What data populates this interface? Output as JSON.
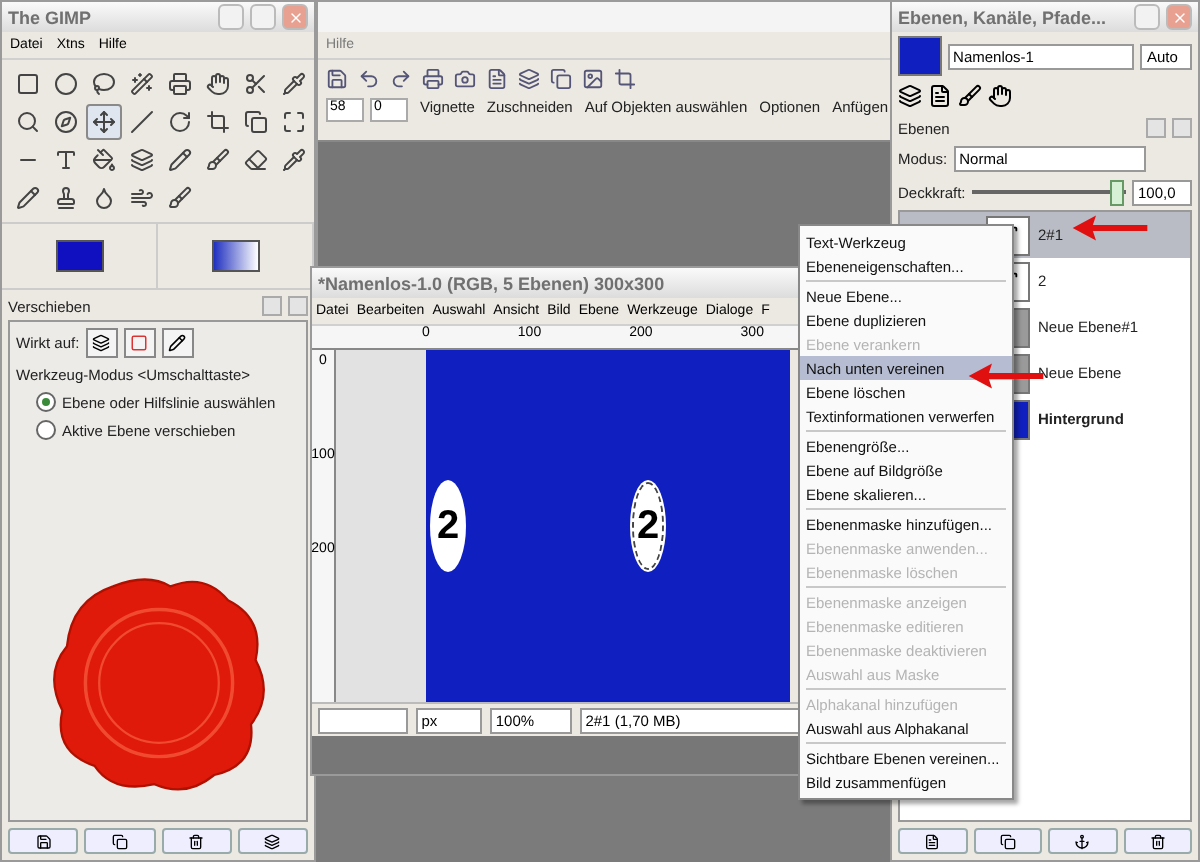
{
  "toolbox": {
    "title": "The GIMP",
    "menu": [
      "Datei",
      "Xtns",
      "Hilfe"
    ],
    "tools": [
      {
        "selected": false
      },
      {
        "selected": false
      },
      {
        "selected": false
      },
      {
        "selected": false
      },
      {
        "selected": false
      },
      {
        "selected": false
      },
      {
        "selected": false
      },
      {
        "selected": false
      },
      {
        "selected": false
      },
      {
        "selected": false
      },
      {
        "selected": true
      },
      {
        "selected": false
      },
      {
        "selected": false
      },
      {
        "selected": false
      },
      {
        "selected": false
      },
      {
        "selected": false
      },
      {
        "selected": false
      },
      {
        "selected": false
      },
      {
        "selected": false
      },
      {
        "selected": false
      },
      {
        "selected": false
      },
      {
        "selected": false
      },
      {
        "selected": false
      },
      {
        "selected": false
      },
      {
        "selected": false
      },
      {
        "selected": false
      },
      {
        "selected": false
      },
      {
        "selected": false
      },
      {
        "selected": false
      }
    ],
    "options": {
      "title": "Verschieben",
      "affects_label": "Wirkt auf:",
      "mode_label": "Werkzeug-Modus  <Umschalttaste>",
      "choices": [
        {
          "label": "Ebene oder Hilfslinie auswählen",
          "selected": true
        },
        {
          "label": "Aktive Ebene verschieben",
          "selected": false
        }
      ]
    }
  },
  "back_window": {
    "menu": [
      "Hilfe"
    ],
    "field_1": "58",
    "field_2": "0",
    "labels": [
      "Vignette",
      "Zuschneiden",
      "Auf Objekten auswählen",
      "Optionen",
      "Anfügen"
    ]
  },
  "image_window": {
    "title": "*Namenlos-1.0 (RGB, 5 Ebenen) 300x300",
    "menu": [
      "Datei",
      "Bearbeiten",
      "Auswahl",
      "Ansicht",
      "Bild",
      "Ebene",
      "Werkzeuge",
      "Dialoge",
      "F"
    ],
    "ruler_marks": [
      "0",
      "100",
      "200",
      "300"
    ],
    "side_marks": [
      "0",
      "100",
      "200"
    ],
    "canvas_labels": [
      {
        "text": "2",
        "selected": false
      },
      {
        "text": "2",
        "selected": true
      }
    ],
    "unit": "px",
    "zoom": "100%",
    "status": "2#1 (1,70 MB)"
  },
  "layers_window": {
    "title": "Ebenen, Kanäle, Pfade...",
    "image": "Namenlos-1",
    "auto": "Auto",
    "panel_title": "Ebenen",
    "mode_label": "Modus:",
    "mode": "Normal",
    "opacity_label": "Deckkraft:",
    "opacity": "100,0",
    "level": 1,
    "layers": [
      {
        "name": "2#1",
        "kind": "text",
        "selected": true
      },
      {
        "name": "2",
        "kind": "text",
        "selected": false
      },
      {
        "name": "Neue Ebene#1",
        "kind": "plain",
        "selected": false
      },
      {
        "name": "Neue Ebene",
        "kind": "plain",
        "selected": false
      },
      {
        "name": "Hintergrund",
        "kind": "background",
        "selected": false
      }
    ]
  },
  "context_menu": [
    {
      "kind": "item",
      "label": "Text-Werkzeug",
      "disabled": false,
      "selected": false
    },
    {
      "kind": "item",
      "label": "Ebeneneigenschaften...",
      "disabled": false,
      "selected": false
    },
    {
      "kind": "separator"
    },
    {
      "kind": "item",
      "label": "Neue Ebene...",
      "disabled": false,
      "selected": false
    },
    {
      "kind": "item",
      "label": "Ebene duplizieren",
      "disabled": false,
      "selected": false
    },
    {
      "kind": "item",
      "label": "Ebene verankern",
      "disabled": true,
      "selected": false
    },
    {
      "kind": "item",
      "label": "Nach unten vereinen",
      "disabled": false,
      "selected": true
    },
    {
      "kind": "item",
      "label": "Ebene löschen",
      "disabled": false,
      "selected": false
    },
    {
      "kind": "item",
      "label": "Textinformationen verwerfen",
      "disabled": false,
      "selected": false
    },
    {
      "kind": "separator"
    },
    {
      "kind": "item",
      "label": "Ebenengröße...",
      "disabled": false,
      "selected": false
    },
    {
      "kind": "item",
      "label": "Ebene auf Bildgröße",
      "disabled": false,
      "selected": false
    },
    {
      "kind": "item",
      "label": "Ebene skalieren...",
      "disabled": false,
      "selected": false
    },
    {
      "kind": "separator"
    },
    {
      "kind": "item",
      "label": "Ebenenmaske hinzufügen...",
      "disabled": false,
      "selected": false
    },
    {
      "kind": "item",
      "label": "Ebenenmaske anwenden...",
      "disabled": true,
      "selected": false
    },
    {
      "kind": "item",
      "label": "Ebenenmaske löschen",
      "disabled": true,
      "selected": false
    },
    {
      "kind": "separator"
    },
    {
      "kind": "item",
      "label": "Ebenenmaske anzeigen",
      "disabled": true,
      "selected": false
    },
    {
      "kind": "item",
      "label": "Ebenenmaske editieren",
      "disabled": true,
      "selected": false
    },
    {
      "kind": "item",
      "label": "Ebenenmaske deaktivieren",
      "disabled": true,
      "selected": false
    },
    {
      "kind": "item",
      "label": "Auswahl aus Maske",
      "disabled": true,
      "selected": false
    },
    {
      "kind": "separator"
    },
    {
      "kind": "item",
      "label": "Alphakanal hinzufügen",
      "disabled": true,
      "selected": false
    },
    {
      "kind": "item",
      "label": "Auswahl aus Alphakanal",
      "disabled": false,
      "selected": false
    },
    {
      "kind": "separator"
    },
    {
      "kind": "item",
      "label": "Sichtbare Ebenen vereinen...",
      "disabled": false,
      "selected": false
    },
    {
      "kind": "item",
      "label": "Bild zusammenfügen",
      "disabled": false,
      "selected": false
    }
  ]
}
